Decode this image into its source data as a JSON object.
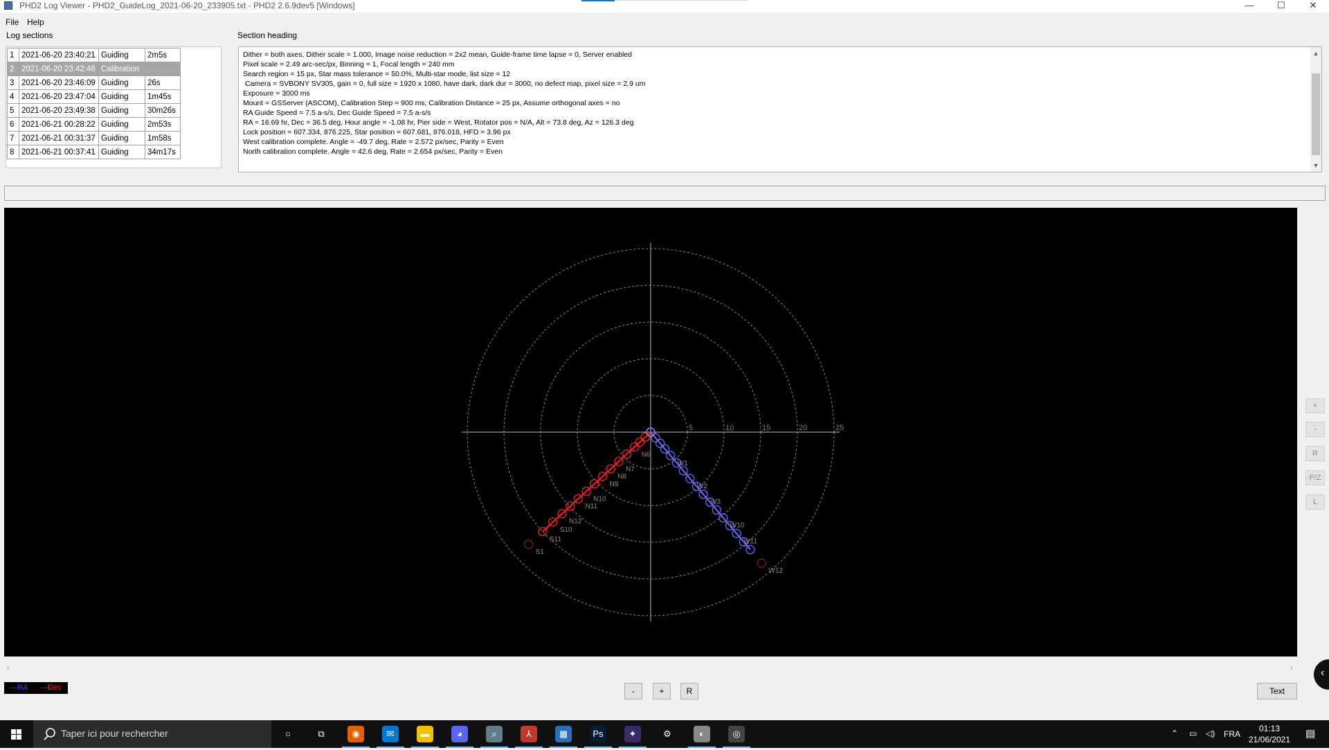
{
  "window": {
    "title": "PHD2 Log Viewer - PHD2_GuideLog_2021-06-20_233905.txt - PHD2 2.6.9dev5 [Windows]",
    "minimize": "—",
    "maximize": "☐",
    "close": "✕"
  },
  "menu": {
    "file": "File",
    "help": "Help"
  },
  "log_sections": {
    "label": "Log sections",
    "rows": [
      {
        "n": "1",
        "time": "2021-06-20 23:40:21",
        "type": "Guiding",
        "dur": "2m5s"
      },
      {
        "n": "2",
        "time": "2021-06-20 23:42:46",
        "type": "Calibration",
        "dur": ""
      },
      {
        "n": "3",
        "time": "2021-06-20 23:46:09",
        "type": "Guiding",
        "dur": "26s"
      },
      {
        "n": "4",
        "time": "2021-06-20 23:47:04",
        "type": "Guiding",
        "dur": "1m45s"
      },
      {
        "n": "5",
        "time": "2021-06-20 23:49:38",
        "type": "Guiding",
        "dur": "30m26s"
      },
      {
        "n": "6",
        "time": "2021-06-21 00:28:22",
        "type": "Guiding",
        "dur": "2m53s"
      },
      {
        "n": "7",
        "time": "2021-06-21 00:31:37",
        "type": "Guiding",
        "dur": "1m58s"
      },
      {
        "n": "8",
        "time": "2021-06-21 00:37:41",
        "type": "Guiding",
        "dur": "34m17s"
      }
    ]
  },
  "section_heading": {
    "label": "Section heading",
    "lines": [
      "Dither = both axes, Dither scale = 1.000, Image noise reduction = 2x2 mean, Guide-frame time lapse = 0, Server enabled",
      "Pixel scale = 2.49 arc-sec/px, Binning = 1, Focal length = 240 mm",
      "Search region = 15 px, Star mass tolerance = 50.0%, Multi-star mode, list size = 12",
      " Camera = SVBONY SV305, gain = 0, full size = 1920 x 1080, have dark, dark dur = 3000, no defect map, pixel size = 2.9 um",
      "Exposure = 3000 ms",
      "Mount = GSServer (ASCOM), Calibration Step = 900 ms, Calibration Distance = 25 px, Assume orthogonal axes = no",
      "RA Guide Speed = 7.5 a-s/s, Dec Guide Speed = 7.5 a-s/s",
      "RA = 16.69 hr, Dec = 36.5 deg, Hour angle = -1.08 hr, Pier side = West, Rotator pos = N/A, Alt = 73.8 deg, Az = 126.3 deg",
      "Lock position = 607.334, 876.225, Star position = 607.681, 876.018, HFD = 3.96 px",
      "West calibration complete. Angle = -49.7 deg, Rate = 2.572 px/sec, Parity = Even",
      "North calibration complete. Angle = 42.6 deg, Rate = 2.654 px/sec, Parity = Even"
    ]
  },
  "side_buttons": [
    "+",
    "-",
    "R",
    "P/Z",
    "L"
  ],
  "legend": {
    "ra": "—RA",
    "dec": "—Dec"
  },
  "bottom_buttons": {
    "minus": "-",
    "plus": "+",
    "reset": "R",
    "text": "Text"
  },
  "chart_data": {
    "type": "scatter",
    "ring_tick_labels": [
      "5",
      "10",
      "15",
      "20",
      "25"
    ],
    "rlim": [
      0,
      25
    ],
    "grid": true,
    "series": [
      {
        "name": "RA",
        "color": "#6a6aff",
        "angle_deg": -49.7,
        "step_distances": [
          0,
          1,
          2,
          3,
          4.2,
          5.5,
          6.9,
          8.3,
          9.7,
          11.1,
          12.5,
          13.9,
          15.3,
          16.7,
          18.1,
          19.6,
          21.0,
          23.4
        ],
        "labels": [
          "W1",
          "W2",
          "W3",
          "W10",
          "W11",
          "W12"
        ]
      },
      {
        "name": "Dec",
        "color": "#ff2020",
        "angle_deg": 42.6,
        "step_distances": [
          0,
          1,
          2,
          3,
          4.4,
          5.9,
          7.4,
          8.9,
          10.4,
          11.9,
          13.4,
          14.9,
          16.4,
          18.1,
          20.0,
          22.6
        ],
        "labels": [
          "N6",
          "N7",
          "N8",
          "N9",
          "N10",
          "N11",
          "N12",
          "S10",
          "S11",
          "S1"
        ]
      }
    ]
  },
  "taskbar": {
    "search_placeholder": "Taper ici pour rechercher",
    "lang": "FRA",
    "time": "01:13",
    "date": "21/06/2021",
    "apps": [
      "cortana-icon",
      "task-view-icon",
      "firefox-icon",
      "mail-icon",
      "file-explorer-icon",
      "discord-icon",
      "search-app-icon",
      "phd2-icon",
      "calculator-icon",
      "photoshop-icon",
      "stellarium-icon",
      "settings-icon",
      "sharpcap-icon",
      "astro-app-icon"
    ]
  }
}
